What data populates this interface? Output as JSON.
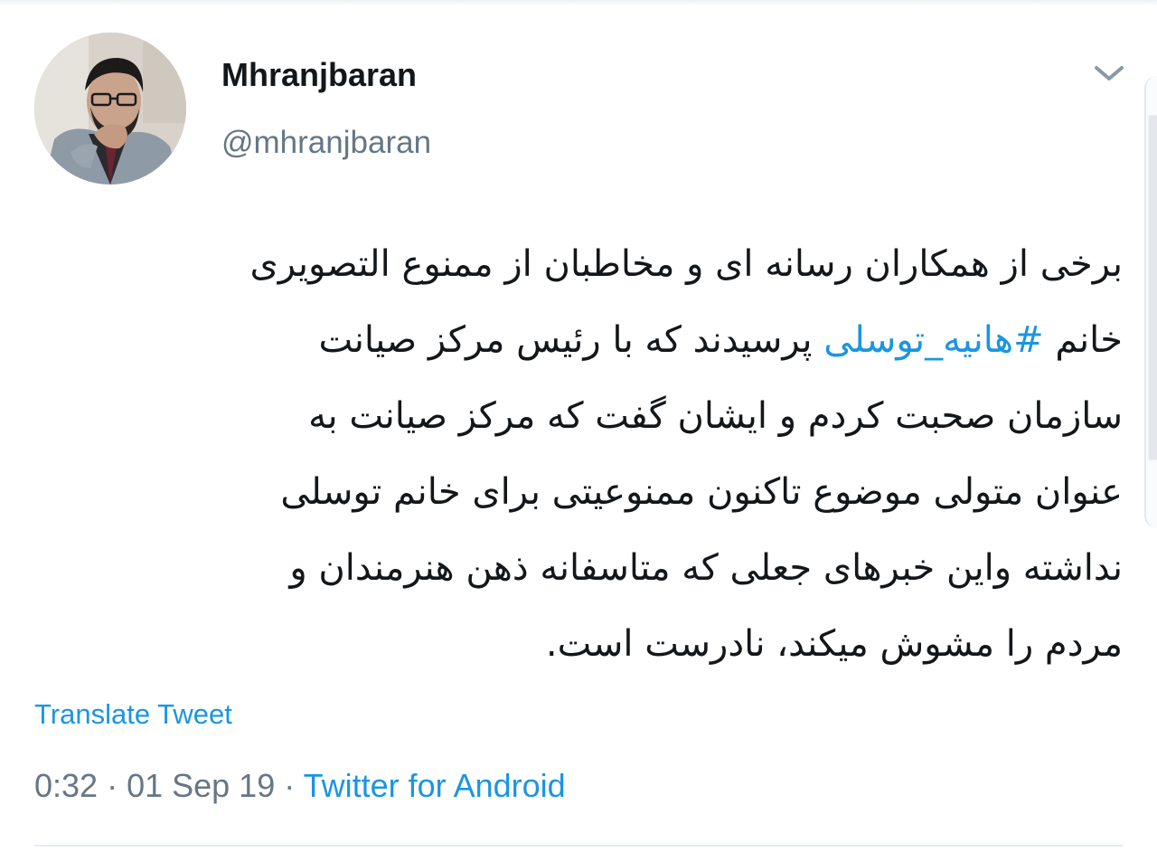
{
  "tweet": {
    "author": {
      "display_name": "Mhranjbaran",
      "handle": "@mhranjbaran",
      "avatar": "profile-photo"
    },
    "body": {
      "line_1": "برخی از همکاران رسانه ای و مخاطبان از ممنوع التصویری",
      "line_2_start": "خانم ",
      "hashtag": "#هانیه_توسلی",
      "line_2_end": " پرسیدند که با رئیس مرکز صیانت",
      "line_3": "سازمان صحبت کردم و ایشان گفت که مرکز صیانت به",
      "line_4": "عنوان متولی موضوع تاکنون ممنوعیتی برای خانم توسلی",
      "line_5": "نداشته واین خبرهای جعلی که متاسفانه ذهن  هنرمندان و",
      "line_6": "مردم را مشوش میکند، نادرست است."
    },
    "translate_label": "Translate Tweet",
    "meta": {
      "time": "0:32",
      "separator_1": " · ",
      "date": "01 Sep 19",
      "separator_2": " · ",
      "source": "Twitter for Android"
    },
    "menu_icon": "chevron-down-icon"
  },
  "colors": {
    "link_blue": "#1b95e0",
    "secondary_gray": "#657786",
    "text": "#14171a"
  }
}
